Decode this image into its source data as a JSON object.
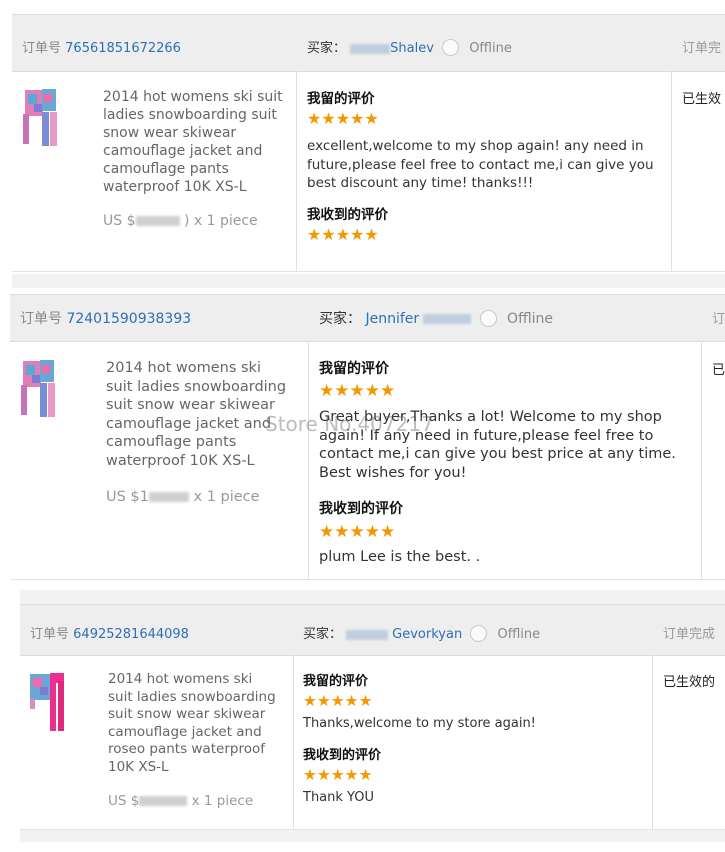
{
  "orders": [
    {
      "order_label": "订单号",
      "order_number": "76561851672266",
      "buyer_label": "买家：",
      "buyer_name": "Shalev",
      "buyer_status": "Offline",
      "right_header": "订单完",
      "product_title": "2014 hot womens ski suit ladies snowboarding suit snow wear skiwear camouflage jacket and camouflage pants waterproof 10K XS-L",
      "price_prefix": "US $",
      "price_qty": ") x 1 piece",
      "my_review_label": "我留的评价",
      "my_review_stars": "★★★★★",
      "my_review_text": "excellent,welcome to my shop again! any need in future,please feel free to contact me,i can give you best discount any time! thanks!!!",
      "received_label": "我收到的评价",
      "received_stars": "★★★★★",
      "received_text": "",
      "right_status": "已生效"
    },
    {
      "order_label": "订单号",
      "order_number": "72401590938393",
      "buyer_label": "买家：",
      "buyer_name": "Jennifer",
      "buyer_status": "Offline",
      "right_header": "订",
      "product_title": "2014 hot womens ski suit ladies snowboarding suit snow wear skiwear camouflage jacket and camouflage pants waterproof 10K XS-L",
      "price_prefix": "US $1",
      "price_qty": "x 1 piece",
      "my_review_label": "我留的评价",
      "my_review_stars": "★★★★★",
      "my_review_text": "Great buyer,Thanks a lot! Welcome to my shop again! If any need in future,please feel free to contact me,i can give you best price at any time. Best wishes for you!",
      "received_label": "我收到的评价",
      "received_stars": "★★★★★",
      "received_text": "plum Lee is the best. .",
      "right_status": "已"
    },
    {
      "order_label": "订单号",
      "order_number": "64925281644098",
      "buyer_label": "买家：",
      "buyer_name": "Gevorkyan",
      "buyer_status": "Offline",
      "right_header": "订单完成",
      "product_title": "2014 hot womens ski suit ladies snowboarding suit snow wear skiwear camouflage jacket and roseo pants waterproof 10K XS-L",
      "price_prefix": "US $",
      "price_qty": "x 1 piece",
      "my_review_label": "我留的评价",
      "my_review_stars": "★★★★★",
      "my_review_text": "Thanks,welcome to my store again!",
      "received_label": "我收到的评价",
      "received_stars": "★★★★★",
      "received_text": "Thank YOU",
      "right_status": "已生效的"
    }
  ],
  "watermark": "Store No.407217",
  "colors": {
    "link": "#2d6fb5",
    "star": "#f39800",
    "header_bg": "#eeeeee"
  },
  "icons": [
    "buyer-avatar-icon",
    "product-thumbnail",
    "star-rating"
  ]
}
